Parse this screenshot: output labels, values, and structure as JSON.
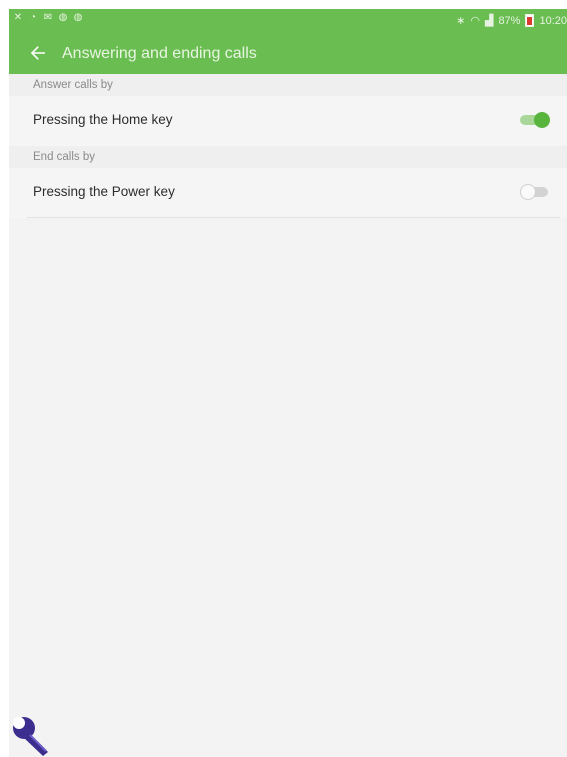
{
  "status_bar": {
    "notification_icons": [
      "missed-call-icon",
      "notification-icon",
      "email-icon",
      "app-icon",
      "app-icon"
    ],
    "battery_percent": "87%",
    "time": "10:20"
  },
  "app_bar": {
    "title": "Answering and ending calls"
  },
  "sections": [
    {
      "header": "Answer calls by",
      "item": {
        "label": "Pressing the Home key",
        "enabled": true
      }
    },
    {
      "header": "End calls by",
      "item": {
        "label": "Pressing the Power key",
        "enabled": false
      }
    }
  ],
  "colors": {
    "accent": "#6abd51",
    "switch_on": "#58b43c",
    "background": "#f3f3f3"
  }
}
